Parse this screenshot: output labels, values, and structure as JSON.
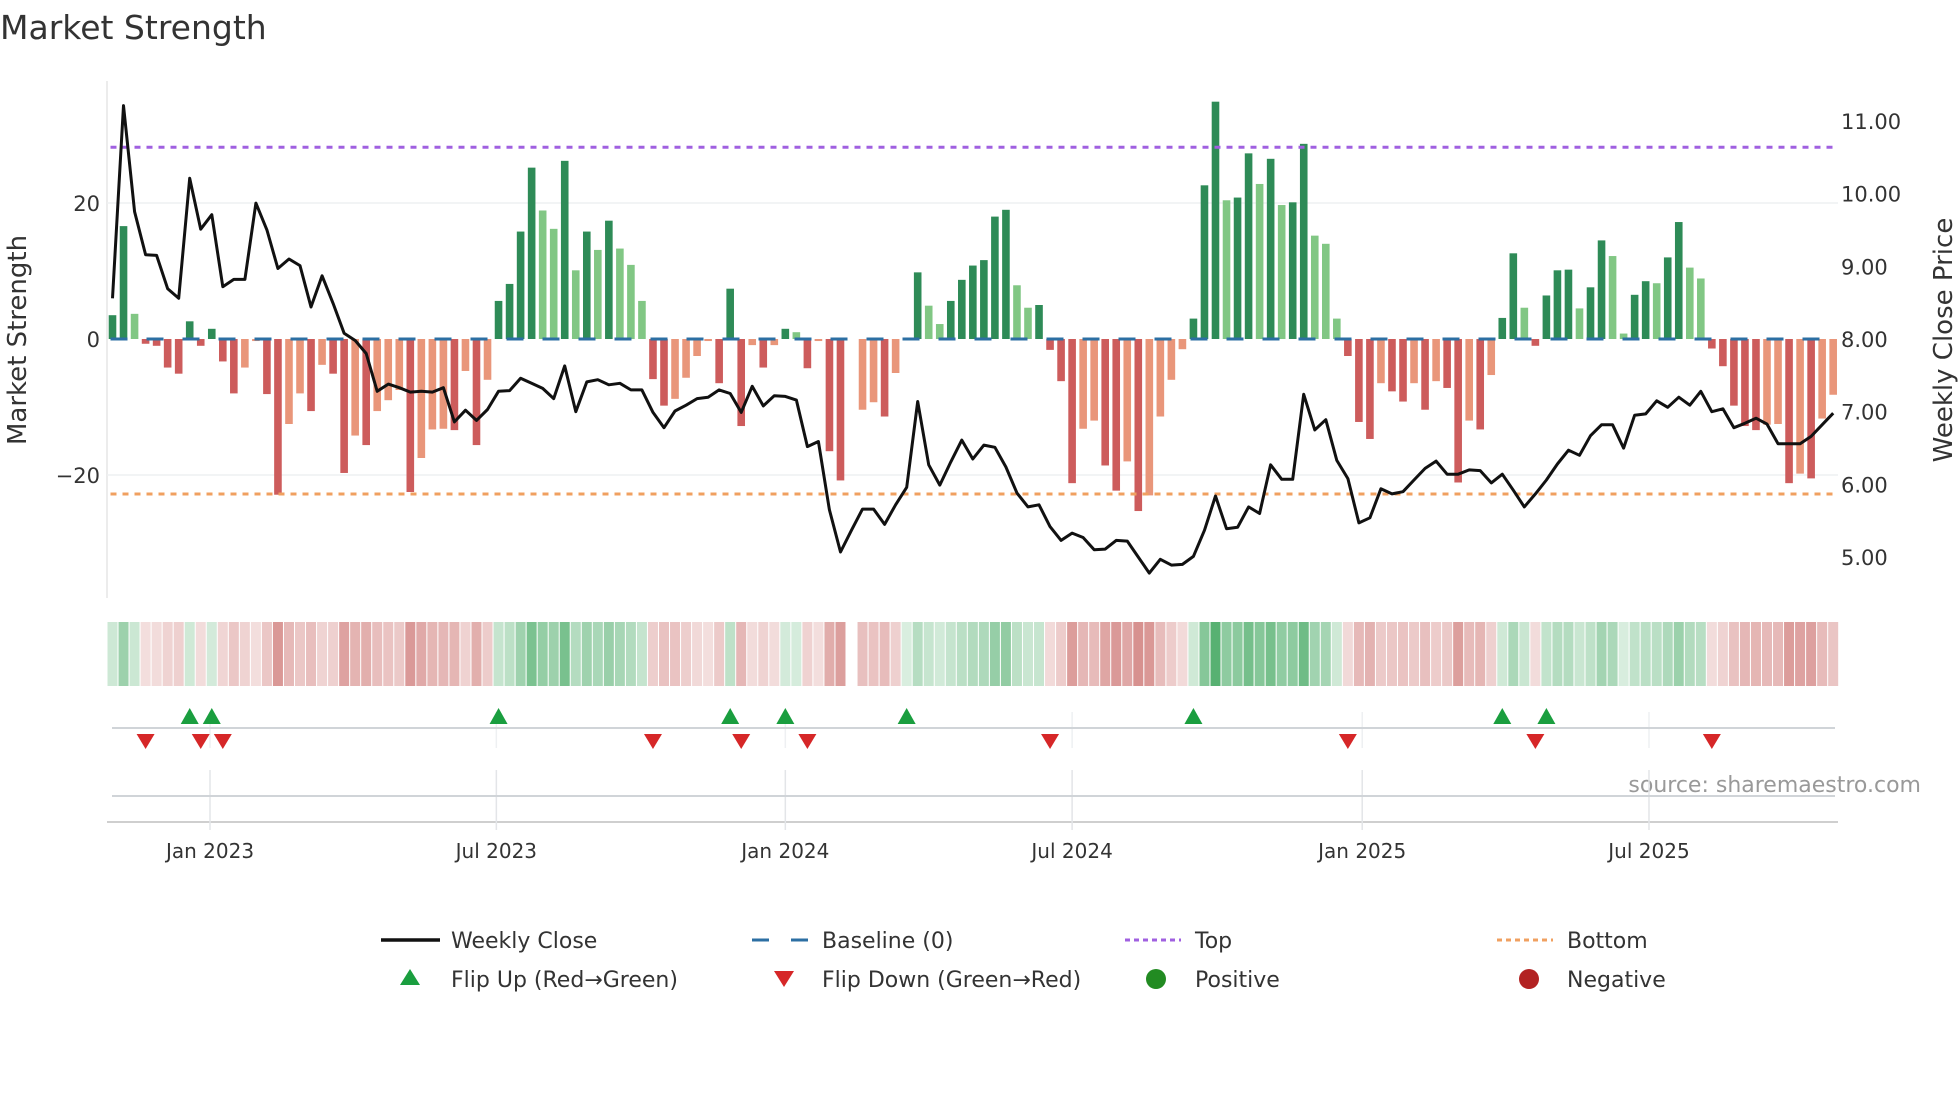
{
  "chart_data": {
    "type": "bar",
    "title": "Market Strength",
    "ylabel": "Market Strength",
    "y2label": "Weekly Close Price",
    "ylim": [
      -38,
      38
    ],
    "y2lim": [
      4.44,
      11.55
    ],
    "yticks": [
      {
        "v": 20,
        "label": "20"
      },
      {
        "v": 0,
        "label": "0"
      },
      {
        "v": -20,
        "label": "−20"
      }
    ],
    "y2ticks": [
      {
        "v": 11,
        "label": "11.00"
      },
      {
        "v": 10,
        "label": "10.00"
      },
      {
        "v": 9,
        "label": "9.00"
      },
      {
        "v": 8,
        "label": "8.00"
      },
      {
        "v": 7,
        "label": "7.00"
      },
      {
        "v": 6,
        "label": "6.00"
      },
      {
        "v": 5,
        "label": "5.00"
      }
    ],
    "xticks": [
      {
        "at_week": 8.84,
        "label": "Jan 2023"
      },
      {
        "at_week": 34.8,
        "label": "Jul 2023"
      },
      {
        "at_week": 61.0,
        "label": "Jan 2024"
      },
      {
        "at_week": 87.0,
        "label": "Jul 2024"
      },
      {
        "at_week": 113.3,
        "label": "Jan 2025"
      },
      {
        "at_week": 139.3,
        "label": "Jul 2025"
      }
    ],
    "top_level": 28.2,
    "bottom_level": -22.8,
    "baseline": 0,
    "grid": true,
    "strength": [
      3.5,
      16.6,
      3.7,
      -0.7,
      -1,
      -4.2,
      -5.1,
      2.6,
      -1,
      1.5,
      -3.3,
      -8,
      -4.2,
      -0.3,
      -8.1,
      -22.9,
      -12.5,
      -8,
      -10.6,
      -3.8,
      -5.1,
      -19.7,
      -14.2,
      -15.6,
      -10.6,
      -9,
      -7.5,
      -22.5,
      -17.5,
      -13.3,
      -13.2,
      -13.4,
      -4.7,
      -15.6,
      -6,
      5.6,
      8.1,
      15.8,
      25.2,
      18.9,
      16.2,
      26.2,
      10.1,
      15.8,
      13.1,
      17.4,
      13.3,
      10.9,
      5.6,
      -5.9,
      -9.8,
      -8.8,
      -5.7,
      -2.5,
      -0.3,
      -6.5,
      7.4,
      -12.8,
      -0.9,
      -4.2,
      -0.9,
      1.5,
      1.0,
      -4.3,
      -0.3,
      -16.5,
      -20.8,
      null,
      -10.4,
      -9.3,
      -11.4,
      -5,
      0.2,
      9.8,
      4.9,
      2.2,
      5.6,
      8.7,
      10.8,
      11.6,
      18,
      19,
      7.9,
      4.6,
      5,
      -1.6,
      -6.2,
      -21.2,
      -13.2,
      -12,
      -18.6,
      -22.3,
      -18,
      -25.3,
      -23,
      -11.4,
      -6,
      -1.5,
      3,
      22.6,
      34.9,
      20.4,
      20.8,
      27.3,
      22.8,
      26.5,
      19.7,
      20.1,
      28.7,
      15.2,
      14,
      3,
      -2.5,
      -12.2,
      -14.7,
      -6.5,
      -7.7,
      -9.2,
      -6.5,
      -10.4,
      -6.2,
      -7.2,
      -21.1,
      -12,
      -13.3,
      -5.3,
      3.1,
      12.6,
      4.6,
      -1,
      6.4,
      10.1,
      10.2,
      4.5,
      7.6,
      14.5,
      12.2,
      0.8,
      6.5,
      8.5,
      8.2,
      12,
      17.2,
      10.5,
      8.9,
      -1.4,
      -4,
      -9.8,
      -12.8,
      -13.4,
      -12.6,
      -12.5,
      -21.2,
      -19.8,
      -20.5,
      -11.7,
      -8.2
    ],
    "weekly_close": [
      8.56,
      11.21,
      9.75,
      9.16,
      9.15,
      8.69,
      8.56,
      10.21,
      9.51,
      9.71,
      8.72,
      8.82,
      8.82,
      9.87,
      9.5,
      8.97,
      9.1,
      9.01,
      8.44,
      8.87,
      8.49,
      8.08,
      7.98,
      7.8,
      7.28,
      7.38,
      7.33,
      7.27,
      7.28,
      7.27,
      7.33,
      6.86,
      7.02,
      6.88,
      7.03,
      7.28,
      7.29,
      7.46,
      7.39,
      7.32,
      7.18,
      7.63,
      7.0,
      7.41,
      7.44,
      7.37,
      7.39,
      7.3,
      7.3,
      6.99,
      6.78,
      7.01,
      7.09,
      7.18,
      7.2,
      7.3,
      7.25,
      6.99,
      7.35,
      7.08,
      7.22,
      7.21,
      7.16,
      6.52,
      6.59,
      5.65,
      5.07,
      5.37,
      5.66,
      5.66,
      5.45,
      5.72,
      5.96,
      7.14,
      6.27,
      5.99,
      6.31,
      6.61,
      6.35,
      6.54,
      6.51,
      6.24,
      5.88,
      5.69,
      5.72,
      5.42,
      5.23,
      5.33,
      5.27,
      5.1,
      5.11,
      5.23,
      5.22,
      5.0,
      4.78,
      4.97,
      4.89,
      4.9,
      5.01,
      5.37,
      5.84,
      5.39,
      5.41,
      5.69,
      5.6,
      6.27,
      6.07,
      6.07,
      7.24,
      6.75,
      6.89,
      6.33,
      6.08,
      5.47,
      5.54,
      5.94,
      5.87,
      5.9,
      6.06,
      6.22,
      6.32,
      6.14,
      6.14,
      6.2,
      6.19,
      6.02,
      6.14,
      5.92,
      5.69,
      5.87,
      6.06,
      6.28,
      6.47,
      6.4,
      6.67,
      6.82,
      6.82,
      6.5,
      6.95,
      6.97,
      7.15,
      7.06,
      7.2,
      7.09,
      7.28,
      7.0,
      7.04,
      6.78,
      6.84,
      6.91,
      6.83,
      6.56,
      6.56,
      6.56,
      6.66,
      6.82,
      6.98
    ],
    "legend_position": "bottom",
    "legend": [
      {
        "label": "Weekly Close",
        "kind": "line"
      },
      {
        "label": "Baseline (0)",
        "kind": "dash"
      },
      {
        "label": "Top",
        "kind": "dot-purple"
      },
      {
        "label": "Bottom",
        "kind": "dot-orange"
      },
      {
        "label": "Flip Up (Red→Green)",
        "kind": "tri-up"
      },
      {
        "label": "Flip Down (Green→Red)",
        "kind": "tri-down"
      },
      {
        "label": "Positive",
        "kind": "circle-green"
      },
      {
        "label": "Negative",
        "kind": "circle-red"
      }
    ],
    "source": "source: sharemaestro.com"
  },
  "colors": {
    "pos_strong": "#2e8b57",
    "pos_weak": "#81c784",
    "neg_strong": "#cd5c5c",
    "neg_weak": "#e9967a",
    "heat_pos": "#2e9e4f",
    "heat_neg": "#c0504d",
    "line": "#111111",
    "baseline": "#2c6fa3",
    "top": "#a060e0",
    "bottom": "#f0a060",
    "flip_up": "#1a9e3f",
    "flip_down": "#d62728",
    "positive": "#228b22",
    "negative": "#b22222"
  }
}
